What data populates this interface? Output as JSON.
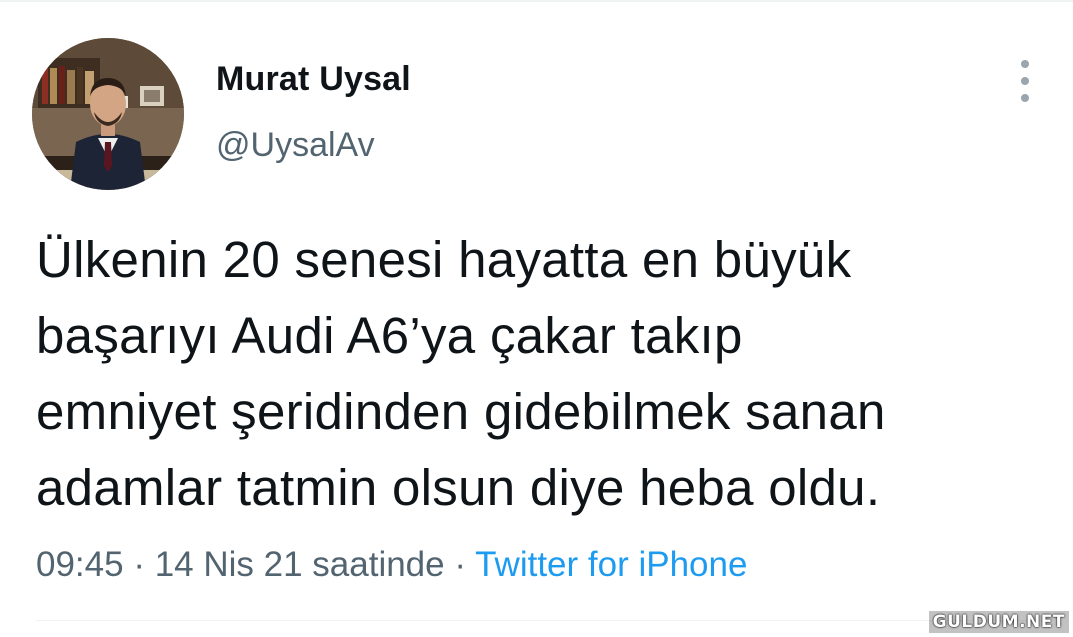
{
  "tweet": {
    "author": {
      "name": "Murat Uysal",
      "handle": "@UysalAv",
      "avatar": "profile-photo"
    },
    "more_icon": "more-vertical-icon",
    "text_lines": [
      "Ülkenin 20 senesi hayatta en büyük",
      "başarıyı Audi A6’ya çakar takıp",
      "emniyet şeridinden gidebilmek sanan",
      "adamlar tatmin olsun diye heba oldu."
    ],
    "time": "09:45",
    "separator": " · ",
    "date": "14 Nis 21 saatinde",
    "source": "Twitter for iPhone"
  },
  "watermark": "GULDUM.NET",
  "colors": {
    "text": "#0f1419",
    "secondary": "#536471",
    "link": "#1d9bf0",
    "divider": "#eff3f4"
  }
}
